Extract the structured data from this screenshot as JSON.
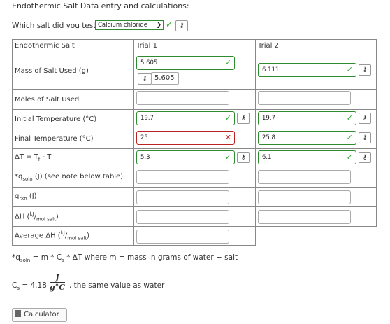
{
  "heading": "Endothermic Salt Data entry and calculations:",
  "salt_question": "Which salt did you test",
  "salt_selected": "Calcium chloride",
  "columns": {
    "label": "Endothermic Salt",
    "trial1": "Trial 1",
    "trial2": "Trial 2"
  },
  "rows": {
    "mass": "Mass of Salt Used (g)",
    "moles": "Moles of Salt Used",
    "t_init": "Initial Temperature (°C)",
    "t_final": "Final Temperature (°C)",
    "delta_t": "ΔT = T",
    "q_soln": "(J) (see note below table)",
    "q_rxn": "(J)",
    "delta_h": "ΔH (",
    "avg_delta_h": "Average ΔH ("
  },
  "trial1": {
    "mass": "5.605",
    "mass_revealed": "5.605",
    "t_init": "19.7",
    "t_final": "25",
    "delta_t": "5.3"
  },
  "trial2": {
    "mass": "6.111",
    "t_init": "19.7",
    "t_final": "25.8",
    "delta_t": "6.1"
  },
  "note": "= m * C",
  "note_end": "* ΔT  where m = mass in grams of water + salt",
  "cs_label": "C",
  "cs_value": "= 4.18",
  "cs_unit_num": "J",
  "cs_unit_den": "g°C",
  "cs_same": ", the same value as water",
  "calculator_label": "Calculator",
  "icons": {
    "key": "key-icon",
    "check": "check-icon",
    "cross": "cross-icon"
  }
}
